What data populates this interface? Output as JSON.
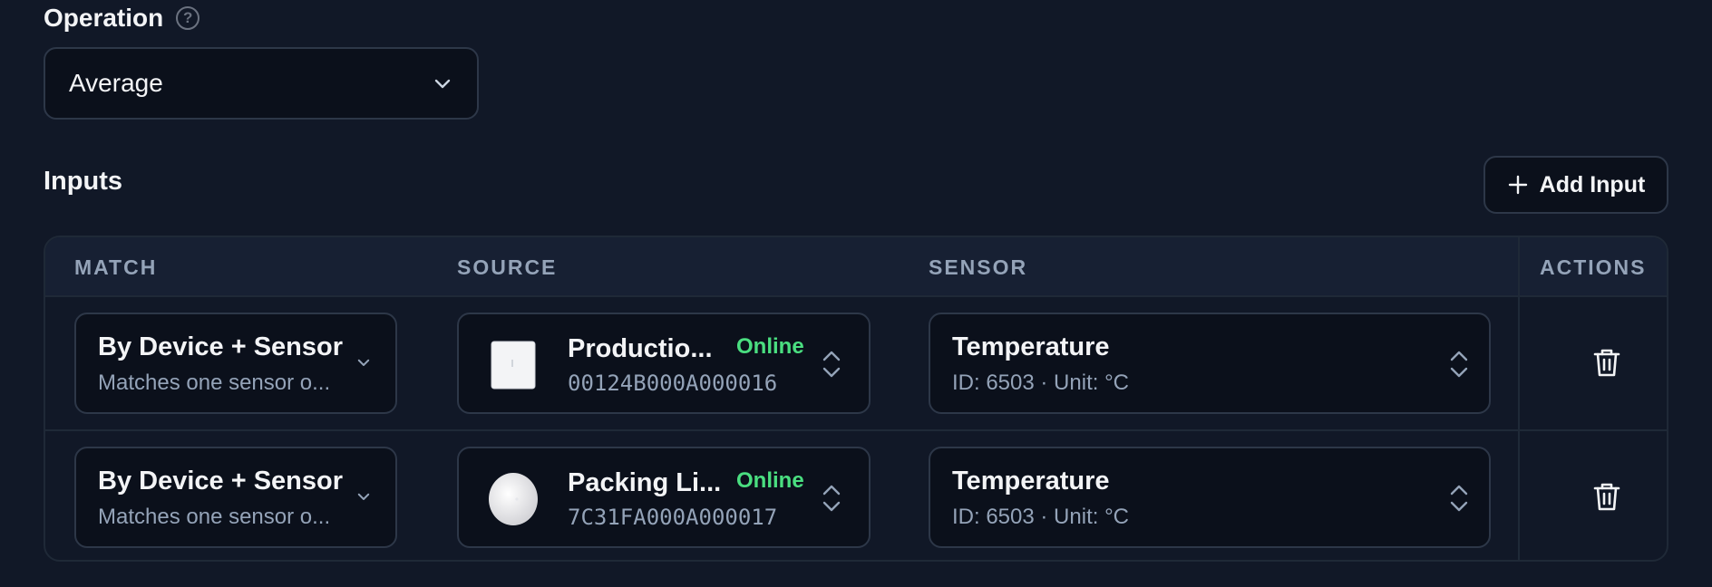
{
  "operation": {
    "label": "Operation",
    "help_icon": "question-circle-icon",
    "selected": "Average"
  },
  "inputs": {
    "title": "Inputs",
    "add_button_label": "Add Input",
    "columns": [
      "MATCH",
      "SOURCE",
      "SENSOR",
      "ACTIONS"
    ],
    "rows": [
      {
        "match_title": "By Device + Sensor",
        "match_sub": "Matches one sensor o...",
        "device_image": "square-sensor-device",
        "source_name": "Productio...",
        "source_status": "Online",
        "source_id": "00124B000A000016",
        "sensor_name": "Temperature",
        "sensor_detail": "ID: 6503 · Unit: °C"
      },
      {
        "match_title": "By Device + Sensor",
        "match_sub": "Matches one sensor o...",
        "device_image": "round-sensor-device",
        "source_name": "Packing Li...",
        "source_status": "Online",
        "source_id": "7C31FA000A000017",
        "sensor_name": "Temperature",
        "sensor_detail": "ID: 6503 · Unit: °C"
      }
    ]
  },
  "colors": {
    "background": "#111827",
    "online": "#4ade80"
  }
}
